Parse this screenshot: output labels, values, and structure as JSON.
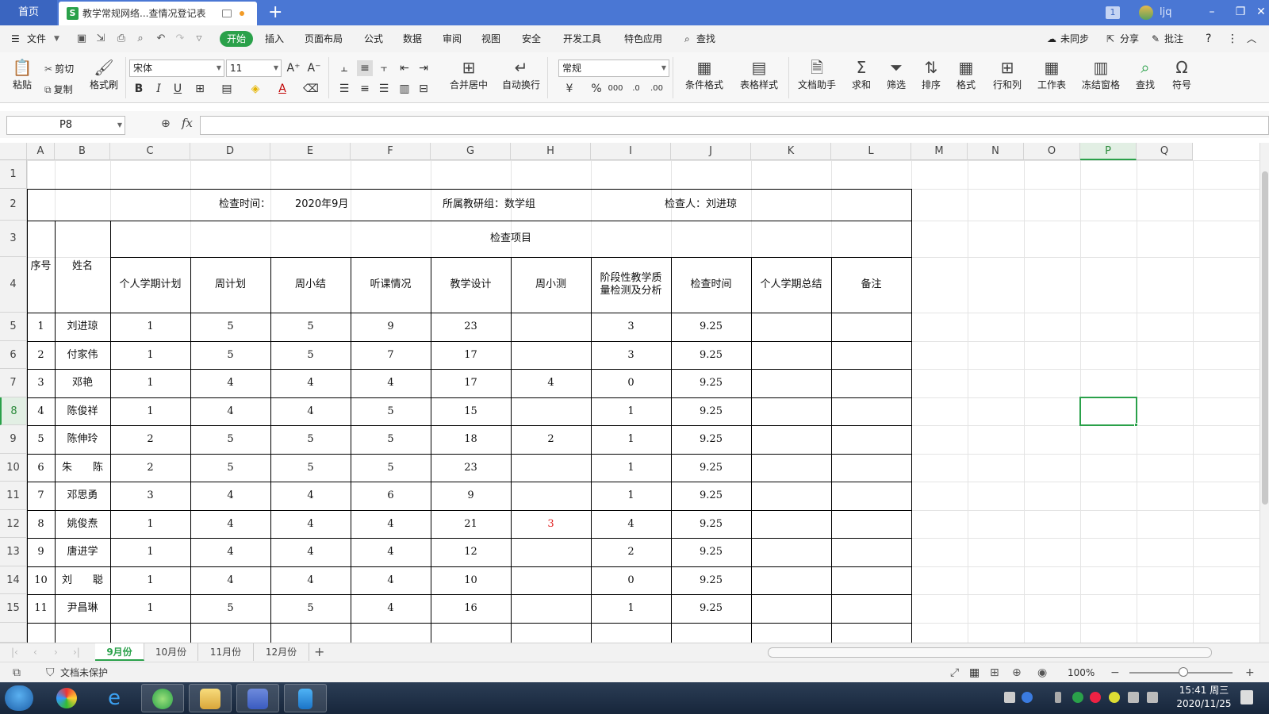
{
  "window": {
    "home_tab": "首页",
    "doc_tab_title": "教学常规网络...查情况登记表",
    "doc_tab_icon": "S",
    "new_tab": "+",
    "badge": "1",
    "username": "ljq"
  },
  "menu": {
    "file": "文件",
    "tabs": [
      "开始",
      "插入",
      "页面布局",
      "公式",
      "数据",
      "审阅",
      "视图",
      "安全",
      "开发工具",
      "特色应用"
    ],
    "search": "查找",
    "sync": "未同步",
    "share": "分享",
    "comment": "批注",
    "help": "?"
  },
  "ribbon": {
    "paste": "粘贴",
    "cut": "剪切",
    "copy": "复制",
    "format_painter": "格式刷",
    "font_name": "宋体",
    "font_size": "11",
    "number_format": "常规",
    "merge_center": "合并居中",
    "wrap_text": "自动换行",
    "conditional_format": "条件格式",
    "table_style": "表格样式",
    "doc_assistant": "文档助手",
    "sum": "求和",
    "filter": "筛选",
    "sort": "排序",
    "format": "格式",
    "row_col": "行和列",
    "worksheet": "工作表",
    "freeze": "冻结窗格",
    "find": "查找",
    "symbol": "符号"
  },
  "formula_bar": {
    "name_box": "P8",
    "fx": "fx",
    "content": ""
  },
  "sheet": {
    "columns": [
      "A",
      "B",
      "C",
      "D",
      "E",
      "F",
      "G",
      "H",
      "I",
      "J",
      "K",
      "L",
      "M",
      "N",
      "O",
      "P",
      "Q"
    ],
    "rows": [
      "1",
      "2",
      "3",
      "4",
      "5",
      "6",
      "7",
      "8",
      "9",
      "10",
      "11",
      "12",
      "13",
      "14",
      "15"
    ],
    "selected_cell": "P8",
    "info_row": {
      "check_time_label": "检查时间：",
      "check_time_value": "2020年9月",
      "group": "所属教研组：数学组",
      "inspector": "检查人：刘进琼"
    },
    "header": {
      "seq": "序号",
      "name": "姓名",
      "items_title": "检查项目",
      "items": [
        "个人学期计划",
        "周计划",
        "周小结",
        "听课情况",
        "教学设计",
        "周小测",
        "阶段性教学质量检测及分析",
        "检查时间",
        "个人学期总结",
        "备注"
      ]
    },
    "records": [
      {
        "seq": "1",
        "name": "刘进琼",
        "plan": "1",
        "weekly": "5",
        "summary": "5",
        "lecture": "9",
        "design": "23",
        "quiz": "",
        "stage": "3",
        "time": "9.25"
      },
      {
        "seq": "2",
        "name": "付家伟",
        "plan": "1",
        "weekly": "5",
        "summary": "5",
        "lecture": "7",
        "design": "17",
        "quiz": "",
        "stage": "3",
        "time": "9.25"
      },
      {
        "seq": "3",
        "name": "邓艳",
        "plan": "1",
        "weekly": "4",
        "summary": "4",
        "lecture": "4",
        "design": "17",
        "quiz": "4",
        "stage": "0",
        "time": "9.25"
      },
      {
        "seq": "4",
        "name": "陈俊祥",
        "plan": "1",
        "weekly": "4",
        "summary": "4",
        "lecture": "5",
        "design": "15",
        "quiz": "",
        "stage": "1",
        "time": "9.25"
      },
      {
        "seq": "5",
        "name": "陈伸玲",
        "plan": "2",
        "weekly": "5",
        "summary": "5",
        "lecture": "5",
        "design": "18",
        "quiz": "2",
        "stage": "1",
        "time": "9.25"
      },
      {
        "seq": "6",
        "name": "朱　　陈",
        "plan": "2",
        "weekly": "5",
        "summary": "5",
        "lecture": "5",
        "design": "23",
        "quiz": "",
        "stage": "1",
        "time": "9.25"
      },
      {
        "seq": "7",
        "name": "邓思勇",
        "plan": "3",
        "weekly": "4",
        "summary": "4",
        "lecture": "6",
        "design": "9",
        "quiz": "",
        "stage": "1",
        "time": "9.25"
      },
      {
        "seq": "8",
        "name": "姚俊焘",
        "plan": "1",
        "weekly": "4",
        "summary": "4",
        "lecture": "4",
        "design": "21",
        "quiz": "3",
        "stage": "4",
        "time": "9.25"
      },
      {
        "seq": "9",
        "name": "唐进学",
        "plan": "1",
        "weekly": "4",
        "summary": "4",
        "lecture": "4",
        "design": "12",
        "quiz": "",
        "stage": "2",
        "time": "9.25"
      },
      {
        "seq": "10",
        "name": "刘　　聪",
        "plan": "1",
        "weekly": "4",
        "summary": "4",
        "lecture": "4",
        "design": "10",
        "quiz": "",
        "stage": "0",
        "time": "9.25"
      },
      {
        "seq": "11",
        "name": "尹昌琳",
        "plan": "1",
        "weekly": "5",
        "summary": "5",
        "lecture": "4",
        "design": "16",
        "quiz": "",
        "stage": "1",
        "time": "9.25"
      }
    ],
    "red_value_color": "#e02020"
  },
  "sheet_tabs": [
    "9月份",
    "10月份",
    "11月份",
    "12月份"
  ],
  "status": {
    "protect": "文档未保护",
    "zoom": "100%"
  },
  "taskbar": {
    "time": "15:41 周三",
    "date": "2020/11/25"
  },
  "colors": {
    "accent": "#2aa14a",
    "titlebar": "#4a77d4"
  }
}
